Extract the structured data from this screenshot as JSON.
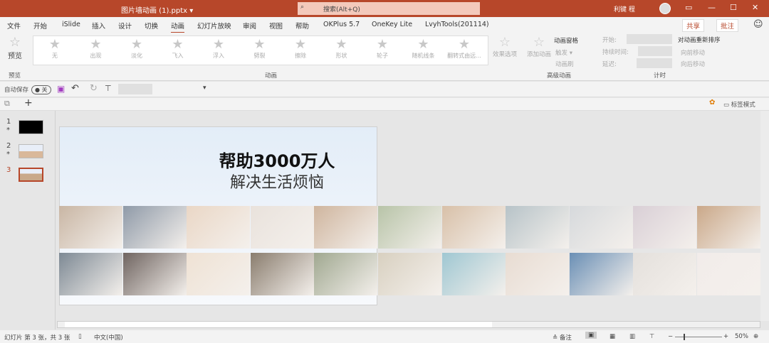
{
  "titlebar": {
    "doc_title": "图片墙动画 (1).pptx  ▾",
    "search_placeholder": "搜索(Alt+Q)",
    "user": "利键 程",
    "restore": "▭",
    "minimize": "—",
    "maximize": "☐",
    "close": "✕"
  },
  "menu": {
    "tabs": [
      "文件",
      "开始",
      "iSlide",
      "插入",
      "设计",
      "切换",
      "动画",
      "幻灯片放映",
      "审阅",
      "视图",
      "帮助",
      "OKPlus 5.7",
      "OneKey Lite",
      "LvyhTools(201114)"
    ],
    "active": "动画",
    "share": "共享",
    "comment": "批注",
    "feedback_icon": "smiley-icon"
  },
  "ribbon": {
    "preview": "预览",
    "preview_group": "预览",
    "effects": [
      "无",
      "出现",
      "淡化",
      "飞入",
      "浮入",
      "劈裂",
      "擦除",
      "形状",
      "轮子",
      "随机线条",
      "翻转式由远..."
    ],
    "effect_options": "效果选项",
    "animation_group": "动画",
    "add_animation": "添加动画",
    "animation_pane": "动画窗格",
    "trigger": "触发 ▾",
    "animation_painter": "动画刷",
    "advanced_group": "高级动画",
    "start": "开始:",
    "duration": "持续时间:",
    "delay": "延迟:",
    "timing_group": "计时",
    "reorder": "对动画重新排序",
    "move_earlier": "向前移动",
    "move_later": "向后移动"
  },
  "qat": {
    "autosave": "自动保存",
    "toggle": "关"
  },
  "panel": {
    "tag_mode": "标签模式"
  },
  "slides": [
    {
      "num": "1",
      "star": "*"
    },
    {
      "num": "2",
      "star": "*"
    },
    {
      "num": "3",
      "star": ""
    }
  ],
  "slide": {
    "title": "帮助3000万人",
    "subtitle": "解决生活烦恼"
  },
  "status": {
    "slide_info": "幻灯片 第 3 张，共 3 张",
    "language": "中文(中国)",
    "notes": "备注",
    "zoom": "50%"
  },
  "colors": {
    "accent": "#b7472a"
  }
}
